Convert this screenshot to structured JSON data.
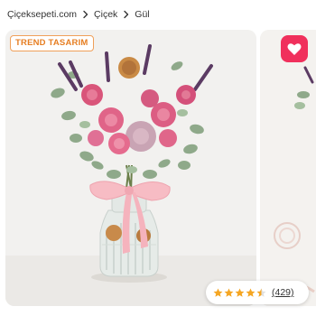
{
  "breadcrumb": {
    "items": [
      "Çiçeksepeti.com",
      "Çiçek",
      "Gül"
    ]
  },
  "product": {
    "badge": "TREND TASARIM",
    "rating_value": 4.5,
    "rating_count": "(429)"
  },
  "colors": {
    "badge_border": "#f0a05a",
    "badge_text": "#e67e22",
    "favorite_bg": "#f0305c",
    "star": "#f5a623"
  },
  "icons": {
    "breadcrumb_separator": "chevron-right-icon",
    "favorite": "heart-icon",
    "rating": "star-icon"
  }
}
